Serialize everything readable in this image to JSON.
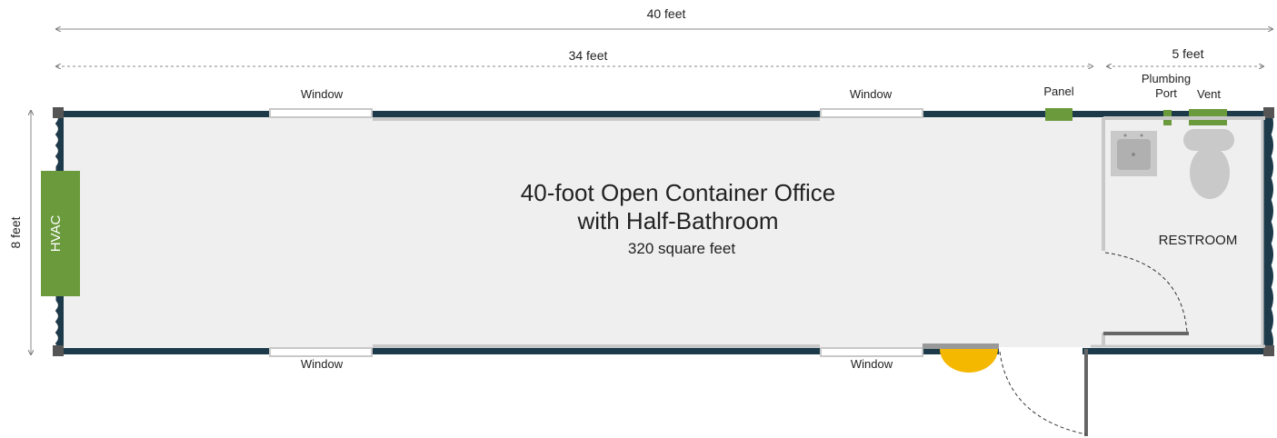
{
  "dimensions": {
    "overall_length": "40 feet",
    "office_length": "34 feet",
    "restroom_length": "5 feet",
    "width": "8 feet"
  },
  "title": {
    "line1": "40-foot Open Container Office",
    "line2": "with Half-Bathroom",
    "area": "320 square feet"
  },
  "labels": {
    "window_top_left": "Window",
    "window_top_right": "Window",
    "window_bottom_left": "Window",
    "window_bottom_right": "Window",
    "panel": "Panel",
    "plumbing_port_line1": "Plumbing",
    "plumbing_port_line2": "Port",
    "vent": "Vent",
    "hvac": "HVAC",
    "restroom": "RESTROOM"
  },
  "colors": {
    "container_wall": "#1d3a4a",
    "floor": "#efefef",
    "interior_wall": "#c8c8c8",
    "equipment": "#6a9a3c",
    "door_step": "#f5b800",
    "fixture": "#c9c9c9"
  }
}
